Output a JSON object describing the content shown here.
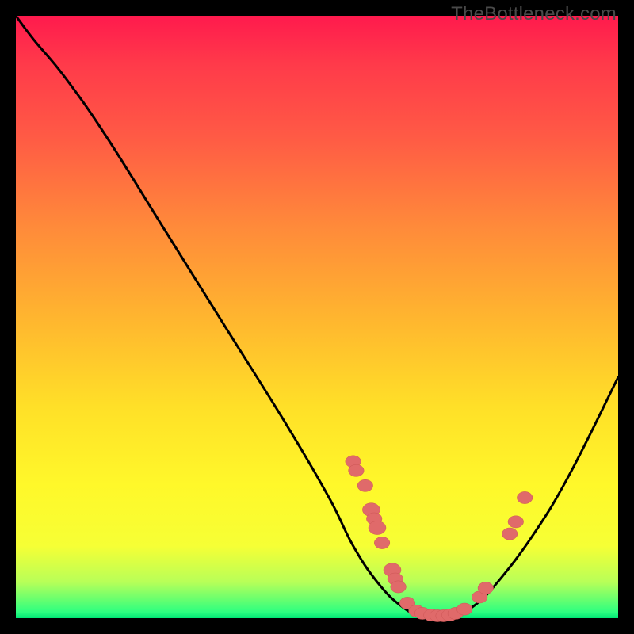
{
  "watermark": "TheBottleneck.com",
  "colors": {
    "frame": "#000000",
    "gradient_top": "#ff1a4d",
    "gradient_mid1": "#ff8a3a",
    "gradient_mid2": "#ffe028",
    "gradient_bottom": "#00e676",
    "curve": "#000000",
    "marker": "#e06a6a"
  },
  "chart_data": {
    "type": "line",
    "title": "",
    "xlabel": "",
    "ylabel": "",
    "xlim": [
      0,
      100
    ],
    "ylim": [
      0,
      100
    ],
    "note": "Axes unlabeled in source. Values are estimated percentage positions within the inner plot area (0=left/bottom, 100=right/top).",
    "series": [
      {
        "name": "curve",
        "x": [
          0,
          3,
          8,
          15,
          25,
          35,
          45,
          52,
          56,
          60,
          64,
          68,
          72,
          76,
          80,
          86,
          92,
          100
        ],
        "y": [
          100,
          96,
          90,
          80,
          64,
          48,
          32,
          20,
          12,
          6,
          2,
          0,
          0,
          2,
          6,
          14,
          24,
          40
        ],
        "note": "Single smooth V-shaped curve; minimum plateau roughly between x=66 and x=74."
      }
    ],
    "markers": [
      {
        "x": 56,
        "y": 26,
        "r": 1.0
      },
      {
        "x": 56.5,
        "y": 24.5,
        "r": 1.0
      },
      {
        "x": 58,
        "y": 22,
        "r": 1.0
      },
      {
        "x": 59,
        "y": 18,
        "r": 1.2
      },
      {
        "x": 59.5,
        "y": 16.5,
        "r": 1.0
      },
      {
        "x": 60,
        "y": 15,
        "r": 1.2
      },
      {
        "x": 60.8,
        "y": 12.5,
        "r": 1.0
      },
      {
        "x": 62.5,
        "y": 8,
        "r": 1.2
      },
      {
        "x": 63,
        "y": 6.5,
        "r": 1.0
      },
      {
        "x": 63.5,
        "y": 5.2,
        "r": 1.0
      },
      {
        "x": 65,
        "y": 2.5,
        "r": 1.0
      },
      {
        "x": 66.5,
        "y": 1.2,
        "r": 1.0
      },
      {
        "x": 67.5,
        "y": 0.8,
        "r": 1.0
      },
      {
        "x": 69,
        "y": 0.5,
        "r": 1.0
      },
      {
        "x": 70,
        "y": 0.4,
        "r": 1.0
      },
      {
        "x": 71,
        "y": 0.4,
        "r": 1.0
      },
      {
        "x": 72,
        "y": 0.5,
        "r": 1.0
      },
      {
        "x": 73,
        "y": 0.8,
        "r": 1.0
      },
      {
        "x": 74.5,
        "y": 1.5,
        "r": 1.0
      },
      {
        "x": 77,
        "y": 3.5,
        "r": 1.0
      },
      {
        "x": 78,
        "y": 5,
        "r": 1.0
      },
      {
        "x": 82,
        "y": 14,
        "r": 1.0
      },
      {
        "x": 83,
        "y": 16,
        "r": 1.0
      },
      {
        "x": 84.5,
        "y": 20,
        "r": 1.0
      }
    ]
  }
}
